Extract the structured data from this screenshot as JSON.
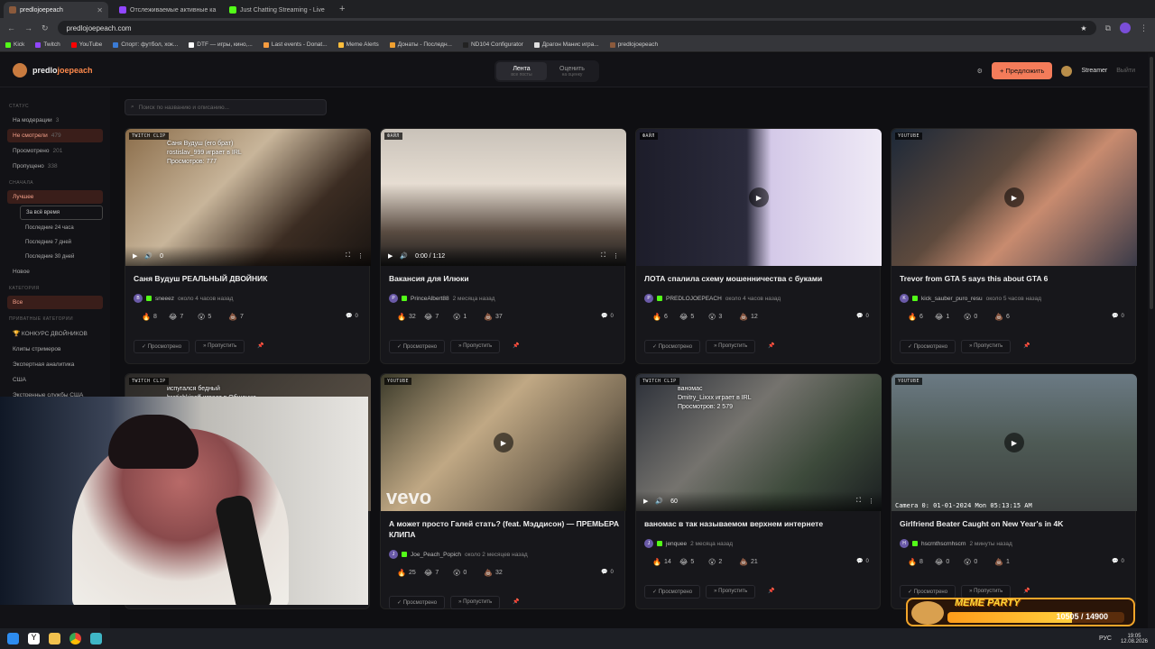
{
  "browser": {
    "tabs": [
      {
        "label": "predlojoepeach",
        "color": "#8b5a3c"
      },
      {
        "label": "Отслеживаемые активные ка",
        "color": "#9146ff"
      },
      {
        "label": "Just Chatting Streaming - Live",
        "color": "#53fc18"
      }
    ],
    "url": "predlojoepeach.com",
    "bookmarks": [
      "Kick",
      "Twitch",
      "YouTube",
      "Спорт: футбол, хок...",
      "DTF — игры, кино,...",
      "Last events - Donat...",
      "Meme Alerts",
      "Донаты - Последн...",
      "ND104 Configurator",
      "Драгон Манис игра...",
      "predlojoepeach"
    ]
  },
  "header": {
    "logo_a": "predlo",
    "logo_b": "joepeach",
    "tabs": [
      {
        "label": "Лента",
        "sub": "все посты"
      },
      {
        "label": "Оценить",
        "sub": "на оценку"
      }
    ],
    "suggest": "+ Предложить",
    "user": "Streamer",
    "logout": "Выйти"
  },
  "sidebar": {
    "status_title": "СТАТУС",
    "status": [
      {
        "label": "На модерации",
        "count": "3"
      },
      {
        "label": "Не смотрели",
        "count": "479"
      },
      {
        "label": "Просмотрено",
        "count": "201"
      },
      {
        "label": "Пропущено",
        "count": "338"
      }
    ],
    "sort_title": "СНАЧАЛА",
    "sort": [
      "Лучшее",
      "За всё время",
      "Последние 24 часа",
      "Последние 7 дней",
      "Последние 30 дней",
      "Новое"
    ],
    "cat_title": "КАТЕГОРИЯ",
    "cat_all": "Все",
    "priv_title": "ПРИВАТНЫЕ КАТЕГОРИИ",
    "cats": [
      "🏆 КОНКУРС ДВОЙНИКОВ",
      "Клипы стримеров",
      "Экспертная аналитика",
      "США",
      "Экстренные службы США"
    ]
  },
  "search_placeholder": "Поиск по названию и описанию...",
  "actions": {
    "viewed": "✓ Просмотрено",
    "skip": "» Пропустить",
    "pin": "📌"
  },
  "cards": [
    {
      "badge": "TWITCH CLIP",
      "title": "Саня Вудуш РЕАЛЬНЫЙ ДВОЙНИК",
      "author": "sneeez",
      "init": "В",
      "ago": "около 4 часов назад",
      "r": [
        "8",
        "7",
        "5",
        "7"
      ],
      "c": "0",
      "overlay": "Саня Вудуш (его брат)",
      "ov2": "rostislav_999  играет в IRL",
      "ov3": "Просмотров: 777",
      "time": "0"
    },
    {
      "badge": "ФАЙЛ",
      "title": "Вакансия для Илюки",
      "author": "PrinceAlbert88",
      "init": "P",
      "ago": "2 месяца назад",
      "r": [
        "32",
        "7",
        "1",
        "37"
      ],
      "c": "0",
      "time": "0:00 / 1:12"
    },
    {
      "badge": "ФАЙЛ",
      "title": "ЛОТА спалила схему мошенничества с буками",
      "author": "PREDLOJOEPEACH",
      "init": "P",
      "ago": "около 4 часов назад",
      "r": [
        "6",
        "5",
        "3",
        "12"
      ],
      "c": "0"
    },
    {
      "badge": "YOUTUBE",
      "title": "Trevor from GTA 5 says this about GTA 6",
      "author": "kick_sauber_puro_resu",
      "init": "K",
      "ago": "около 5 часов назад",
      "r": [
        "6",
        "1",
        "0",
        "6"
      ],
      "c": "0"
    },
    {
      "badge": "TWITCH CLIP",
      "title": "",
      "author": "",
      "init": "",
      "ago": "",
      "r": [
        "",
        "",
        "",
        ""
      ],
      "c": "",
      "overlay": "испугался бедный",
      "ov2": "bratishkinoff  играет в Общение"
    },
    {
      "badge": "YOUTUBE",
      "title": "А может просто Галей стать? (feat. Мэддисон) — ПРЕМЬЕРА КЛИПА",
      "author": "Joe_Peach_Popich",
      "init": "J",
      "ago": "около 2 месяцев назад",
      "r": [
        "25",
        "7",
        "0",
        "32"
      ],
      "c": "0",
      "logo": "vevo"
    },
    {
      "badge": "TWITCH CLIP",
      "title": "ваномас в так называемом верхнем интернете",
      "author": "jenquee",
      "init": "J",
      "ago": "2 месяца назад",
      "r": [
        "14",
        "5",
        "2",
        "21"
      ],
      "c": "0",
      "overlay": "ваномас",
      "ov2": "Dmitry_Lixxx  играет в IRL",
      "ov3": "Просмотров: 2 579",
      "time": "60"
    },
    {
      "badge": "YOUTUBE",
      "title": "Girlfriend Beater Caught on New Year's in 4K",
      "author": "hscrnthscrnhscrn",
      "init": "H",
      "ago": "2 минуты назад",
      "r": [
        "8",
        "0",
        "0",
        "1"
      ],
      "c": "0",
      "stamp": "Camera 0:   01-01-2024 Mon 05:13:15 AM"
    }
  ],
  "meme": {
    "title": "MEME PARTY",
    "progress": "10505 / 14900",
    "fraction": 0.705
  },
  "taskbar": {
    "lang": "РУС",
    "time": "19:05",
    "date": "12.08.2026"
  }
}
